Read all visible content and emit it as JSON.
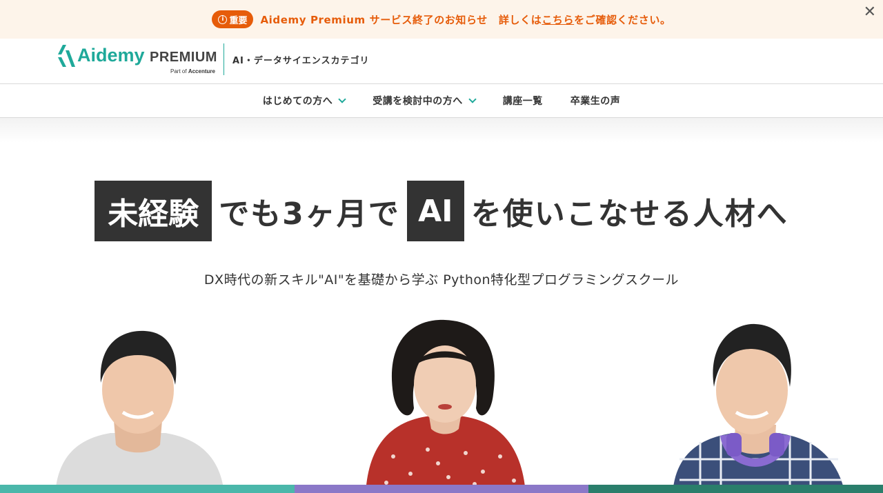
{
  "notice": {
    "badge": "重要",
    "message": "Aidemy Premium サービス終了のお知らせ",
    "detail_prefix": "詳しくは",
    "link": "こちら",
    "detail_suffix": "をご確認ください。",
    "close": "✕"
  },
  "header": {
    "logo_word": "Aidemy",
    "logo_premium": "PREMIUM",
    "logo_sub_prefix": "Part of",
    "logo_sub_brand": "Accenture",
    "category": "AI・データサイエンスカテゴリ"
  },
  "nav": {
    "items": [
      {
        "label": "はじめての方へ"
      },
      {
        "label": "受講を検討中の方へ"
      },
      {
        "label": "講座一覧"
      },
      {
        "label": "卒業生の声"
      }
    ]
  },
  "hero": {
    "box1": "未経験",
    "text1": "でも3ヶ月で",
    "box2": "AI",
    "text2": "を使いこなせる人材へ",
    "tagline": "DX時代の新スキル\"AI\"を基礎から学ぶ Python特化型プログラミングスクール"
  },
  "colors": {
    "accent": "#1fa99a",
    "notice": "#e65c0a",
    "bar_left": "#4bb7aa",
    "bar_middle": "#8b78c8",
    "bar_right": "#2a7e6b"
  }
}
